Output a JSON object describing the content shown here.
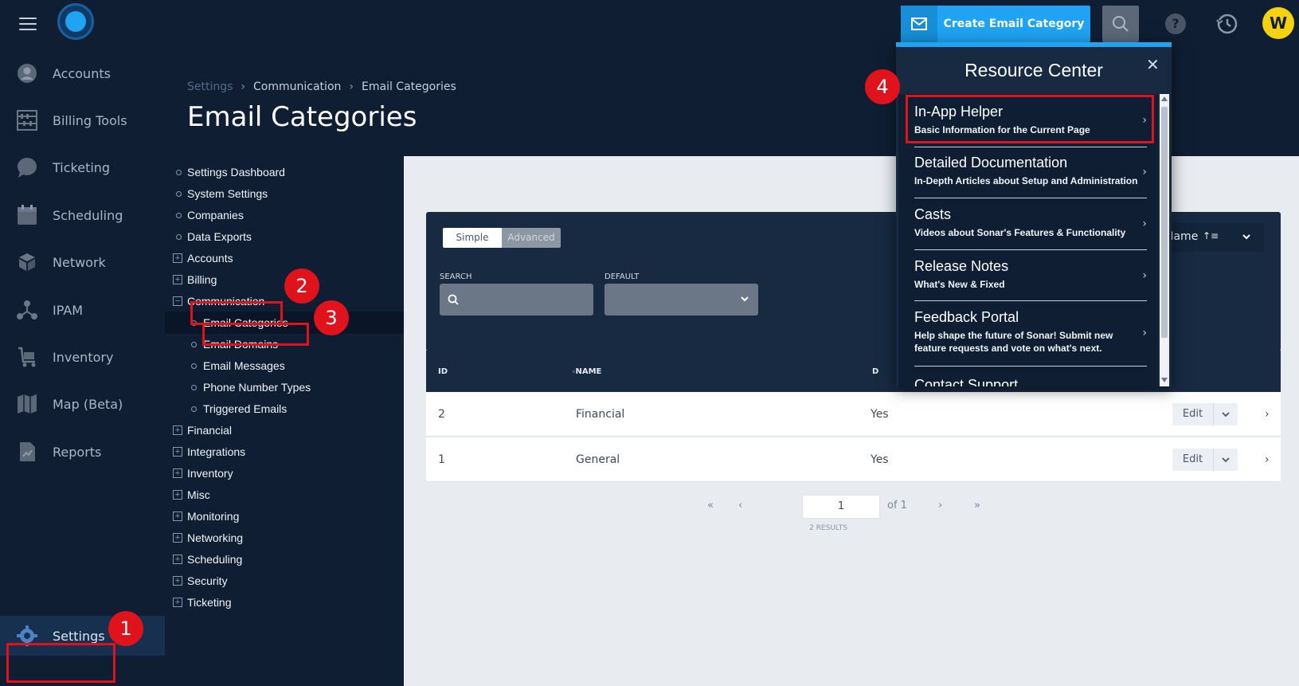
{
  "topbar": {
    "create_button_label": "Create Email Category",
    "avatar_initial": "W",
    "help_label": "?"
  },
  "leftnav": {
    "items": [
      {
        "label": "Accounts",
        "icon": "user-circle-icon"
      },
      {
        "label": "Billing Tools",
        "icon": "abacus-icon"
      },
      {
        "label": "Ticketing",
        "icon": "chat-bubble-icon"
      },
      {
        "label": "Scheduling",
        "icon": "calendar-icon"
      },
      {
        "label": "Network",
        "icon": "cubes-icon"
      },
      {
        "label": "IPAM",
        "icon": "nodes-icon"
      },
      {
        "label": "Inventory",
        "icon": "cart-icon"
      },
      {
        "label": "Map (Beta)",
        "icon": "map-icon"
      },
      {
        "label": "Reports",
        "icon": "report-icon"
      }
    ],
    "settings_label": "Settings"
  },
  "header": {
    "breadcrumb": [
      "Settings",
      "Communication",
      "Email Categories"
    ],
    "title": "Email Categories"
  },
  "tree": {
    "items": [
      {
        "label": "Settings Dashboard",
        "kind": "bullet",
        "level": 0
      },
      {
        "label": "System Settings",
        "kind": "bullet",
        "level": 0
      },
      {
        "label": "Companies",
        "kind": "bullet",
        "level": 0
      },
      {
        "label": "Data Exports",
        "kind": "bullet",
        "level": 0
      },
      {
        "label": "Accounts",
        "kind": "plus",
        "level": 0
      },
      {
        "label": "Billing",
        "kind": "plus",
        "level": 0
      },
      {
        "label": "Communication",
        "kind": "minus",
        "level": 0
      },
      {
        "label": "Email Categories",
        "kind": "bullet",
        "level": 1
      },
      {
        "label": "Email Domains",
        "kind": "bullet",
        "level": 1
      },
      {
        "label": "Email Messages",
        "kind": "bullet",
        "level": 1
      },
      {
        "label": "Phone Number Types",
        "kind": "bullet",
        "level": 1
      },
      {
        "label": "Triggered Emails",
        "kind": "bullet",
        "level": 1
      },
      {
        "label": "Financial",
        "kind": "plus",
        "level": 0
      },
      {
        "label": "Integrations",
        "kind": "plus",
        "level": 0
      },
      {
        "label": "Inventory",
        "kind": "plus",
        "level": 0
      },
      {
        "label": "Misc",
        "kind": "plus",
        "level": 0
      },
      {
        "label": "Monitoring",
        "kind": "plus",
        "level": 0
      },
      {
        "label": "Networking",
        "kind": "plus",
        "level": 0
      },
      {
        "label": "Scheduling",
        "kind": "plus",
        "level": 0
      },
      {
        "label": "Security",
        "kind": "plus",
        "level": 0
      },
      {
        "label": "Ticketing",
        "kind": "plus",
        "level": 0
      }
    ]
  },
  "filters": {
    "toggle_simple": "Simple",
    "toggle_advanced": "Advanced",
    "search_label": "SEARCH",
    "default_label": "DEFAULT",
    "sort_label": "Name"
  },
  "table": {
    "headers": {
      "id": "ID",
      "name": "NAME",
      "default": "D"
    },
    "rows": [
      {
        "id": "2",
        "name": "Financial",
        "default": "Yes",
        "action": "Edit"
      },
      {
        "id": "1",
        "name": "General",
        "default": "Yes",
        "action": "Edit"
      }
    ]
  },
  "pager": {
    "first": "«",
    "prev": "‹",
    "page": "1",
    "of_text": "of 1",
    "next": "›",
    "last": "»",
    "results": "2 RESULTS"
  },
  "resource_center": {
    "title": "Resource Center",
    "close": "✕",
    "items": [
      {
        "title": "In-App Helper",
        "subtitle": "Basic Information for the Current Page"
      },
      {
        "title": "Detailed Documentation",
        "subtitle": "In-Depth Articles about Setup and Administration"
      },
      {
        "title": "Casts",
        "subtitle": "Videos about Sonar's Features & Functionality"
      },
      {
        "title": "Release Notes",
        "subtitle": "What's New & Fixed"
      },
      {
        "title": "Feedback Portal",
        "subtitle": "Help shape the future of Sonar! Submit new feature requests and vote on what's next."
      },
      {
        "title": "Contact Support",
        "subtitle": ""
      }
    ]
  },
  "annotations": {
    "b1": "1",
    "b2": "2",
    "b3": "3",
    "b4": "4",
    "color": "#e0121b"
  }
}
